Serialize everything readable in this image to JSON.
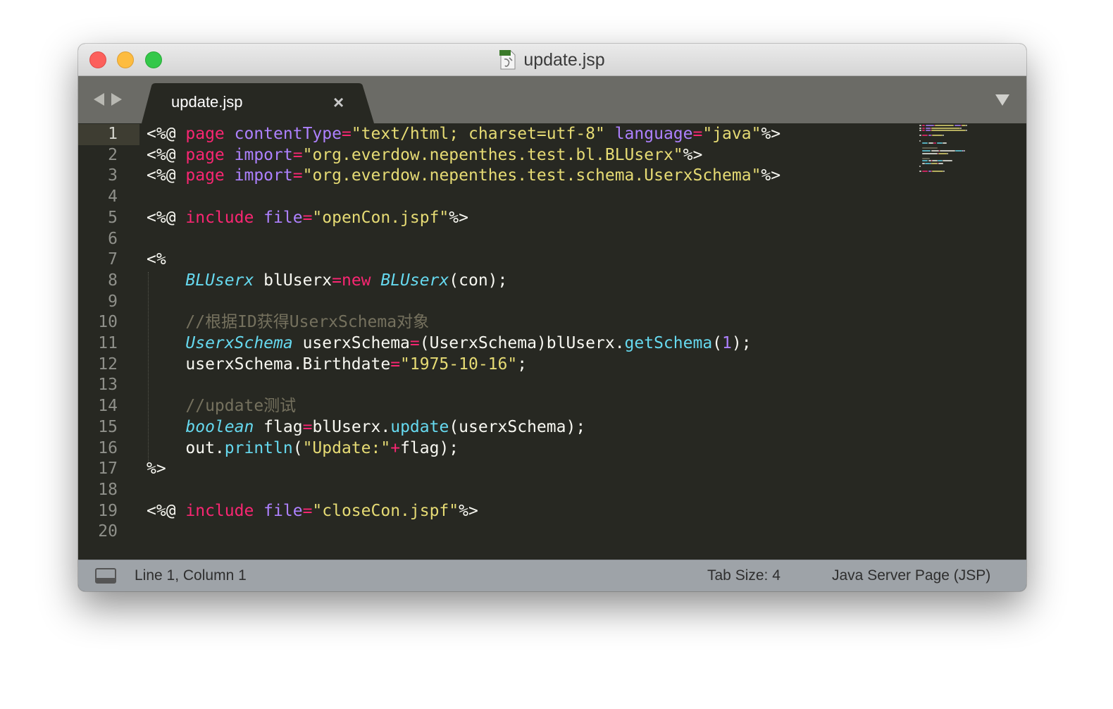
{
  "window": {
    "title": "update.jsp",
    "file_icon": "jsp-file-icon"
  },
  "tabbar": {
    "tabs": [
      {
        "label": "update.jsp",
        "close_glyph": "×"
      }
    ],
    "dropdown_icon": "triangle-down-icon"
  },
  "editor": {
    "active_line": 1,
    "lines": [
      {
        "n": "1",
        "tokens": [
          [
            "pun",
            "<%@ "
          ],
          [
            "kw",
            "page "
          ],
          [
            "attr",
            "contentType"
          ],
          [
            "op",
            "="
          ],
          [
            "str",
            "\"text/html; charset=utf-8\" "
          ],
          [
            "attr",
            "language"
          ],
          [
            "op",
            "="
          ],
          [
            "str",
            "\"java\""
          ],
          [
            "pun",
            "%>"
          ]
        ]
      },
      {
        "n": "2",
        "tokens": [
          [
            "pun",
            "<%@ "
          ],
          [
            "kw",
            "page "
          ],
          [
            "attr",
            "import"
          ],
          [
            "op",
            "="
          ],
          [
            "str",
            "\"org.everdow.nepenthes.test.bl.BLUserx\""
          ],
          [
            "pun",
            "%>"
          ]
        ]
      },
      {
        "n": "3",
        "tokens": [
          [
            "pun",
            "<%@ "
          ],
          [
            "kw",
            "page "
          ],
          [
            "attr",
            "import"
          ],
          [
            "op",
            "="
          ],
          [
            "str",
            "\"org.everdow.nepenthes.test.schema.UserxSchema\""
          ],
          [
            "pun",
            "%>"
          ]
        ]
      },
      {
        "n": "4",
        "tokens": []
      },
      {
        "n": "5",
        "tokens": [
          [
            "pun",
            "<%@ "
          ],
          [
            "kw",
            "include "
          ],
          [
            "attr",
            "file"
          ],
          [
            "op",
            "="
          ],
          [
            "str",
            "\"openCon.jspf\""
          ],
          [
            "pun",
            "%>"
          ]
        ]
      },
      {
        "n": "6",
        "tokens": []
      },
      {
        "n": "7",
        "tokens": [
          [
            "pun",
            "<%"
          ]
        ]
      },
      {
        "n": "8",
        "tokens": [
          [
            "plain",
            "    "
          ],
          [
            "cls",
            "BLUserx"
          ],
          [
            "plain",
            " blUserx"
          ],
          [
            "op",
            "="
          ],
          [
            "kw",
            "new "
          ],
          [
            "cls",
            "BLUserx"
          ],
          [
            "plain",
            "(con);"
          ]
        ]
      },
      {
        "n": "9",
        "tokens": []
      },
      {
        "n": "10",
        "tokens": [
          [
            "plain",
            "    "
          ],
          [
            "cmt",
            "//根据ID获得UserxSchema对象"
          ]
        ]
      },
      {
        "n": "11",
        "tokens": [
          [
            "plain",
            "    "
          ],
          [
            "cls",
            "UserxSchema"
          ],
          [
            "plain",
            " userxSchema"
          ],
          [
            "op",
            "="
          ],
          [
            "plain",
            "(UserxSchema)blUserx."
          ],
          [
            "fn",
            "getSchema"
          ],
          [
            "plain",
            "("
          ],
          [
            "num",
            "1"
          ],
          [
            "plain",
            ");"
          ]
        ]
      },
      {
        "n": "12",
        "tokens": [
          [
            "plain",
            "    userxSchema.Birthdate"
          ],
          [
            "op",
            "="
          ],
          [
            "str",
            "\"1975-10-16\""
          ],
          [
            "plain",
            ";"
          ]
        ]
      },
      {
        "n": "13",
        "tokens": []
      },
      {
        "n": "14",
        "tokens": [
          [
            "plain",
            "    "
          ],
          [
            "cmt",
            "//update测试"
          ]
        ]
      },
      {
        "n": "15",
        "tokens": [
          [
            "plain",
            "    "
          ],
          [
            "cls",
            "boolean"
          ],
          [
            "plain",
            " flag"
          ],
          [
            "op",
            "="
          ],
          [
            "plain",
            "blUserx."
          ],
          [
            "fn",
            "update"
          ],
          [
            "plain",
            "(userxSchema);"
          ]
        ]
      },
      {
        "n": "16",
        "tokens": [
          [
            "plain",
            "    out."
          ],
          [
            "fn",
            "println"
          ],
          [
            "plain",
            "("
          ],
          [
            "str",
            "\"Update:\""
          ],
          [
            "op",
            "+"
          ],
          [
            "plain",
            "flag);"
          ]
        ]
      },
      {
        "n": "17",
        "tokens": [
          [
            "pun",
            "%>"
          ]
        ]
      },
      {
        "n": "18",
        "tokens": []
      },
      {
        "n": "19",
        "tokens": [
          [
            "pun",
            "<%@ "
          ],
          [
            "kw",
            "include "
          ],
          [
            "attr",
            "file"
          ],
          [
            "op",
            "="
          ],
          [
            "str",
            "\"closeCon.jspf\""
          ],
          [
            "pun",
            "%>"
          ]
        ]
      },
      {
        "n": "20",
        "tokens": []
      }
    ]
  },
  "statusbar": {
    "position": "Line 1, Column 1",
    "tab_size": "Tab Size: 4",
    "syntax": "Java Server Page (JSP)",
    "panel_icon": "panel-toggle-icon"
  },
  "colors": {
    "background": "#272822",
    "keyword": "#f92672",
    "attribute": "#ae81ff",
    "string": "#e6db74",
    "type": "#66d9ef",
    "comment": "#75715e"
  }
}
